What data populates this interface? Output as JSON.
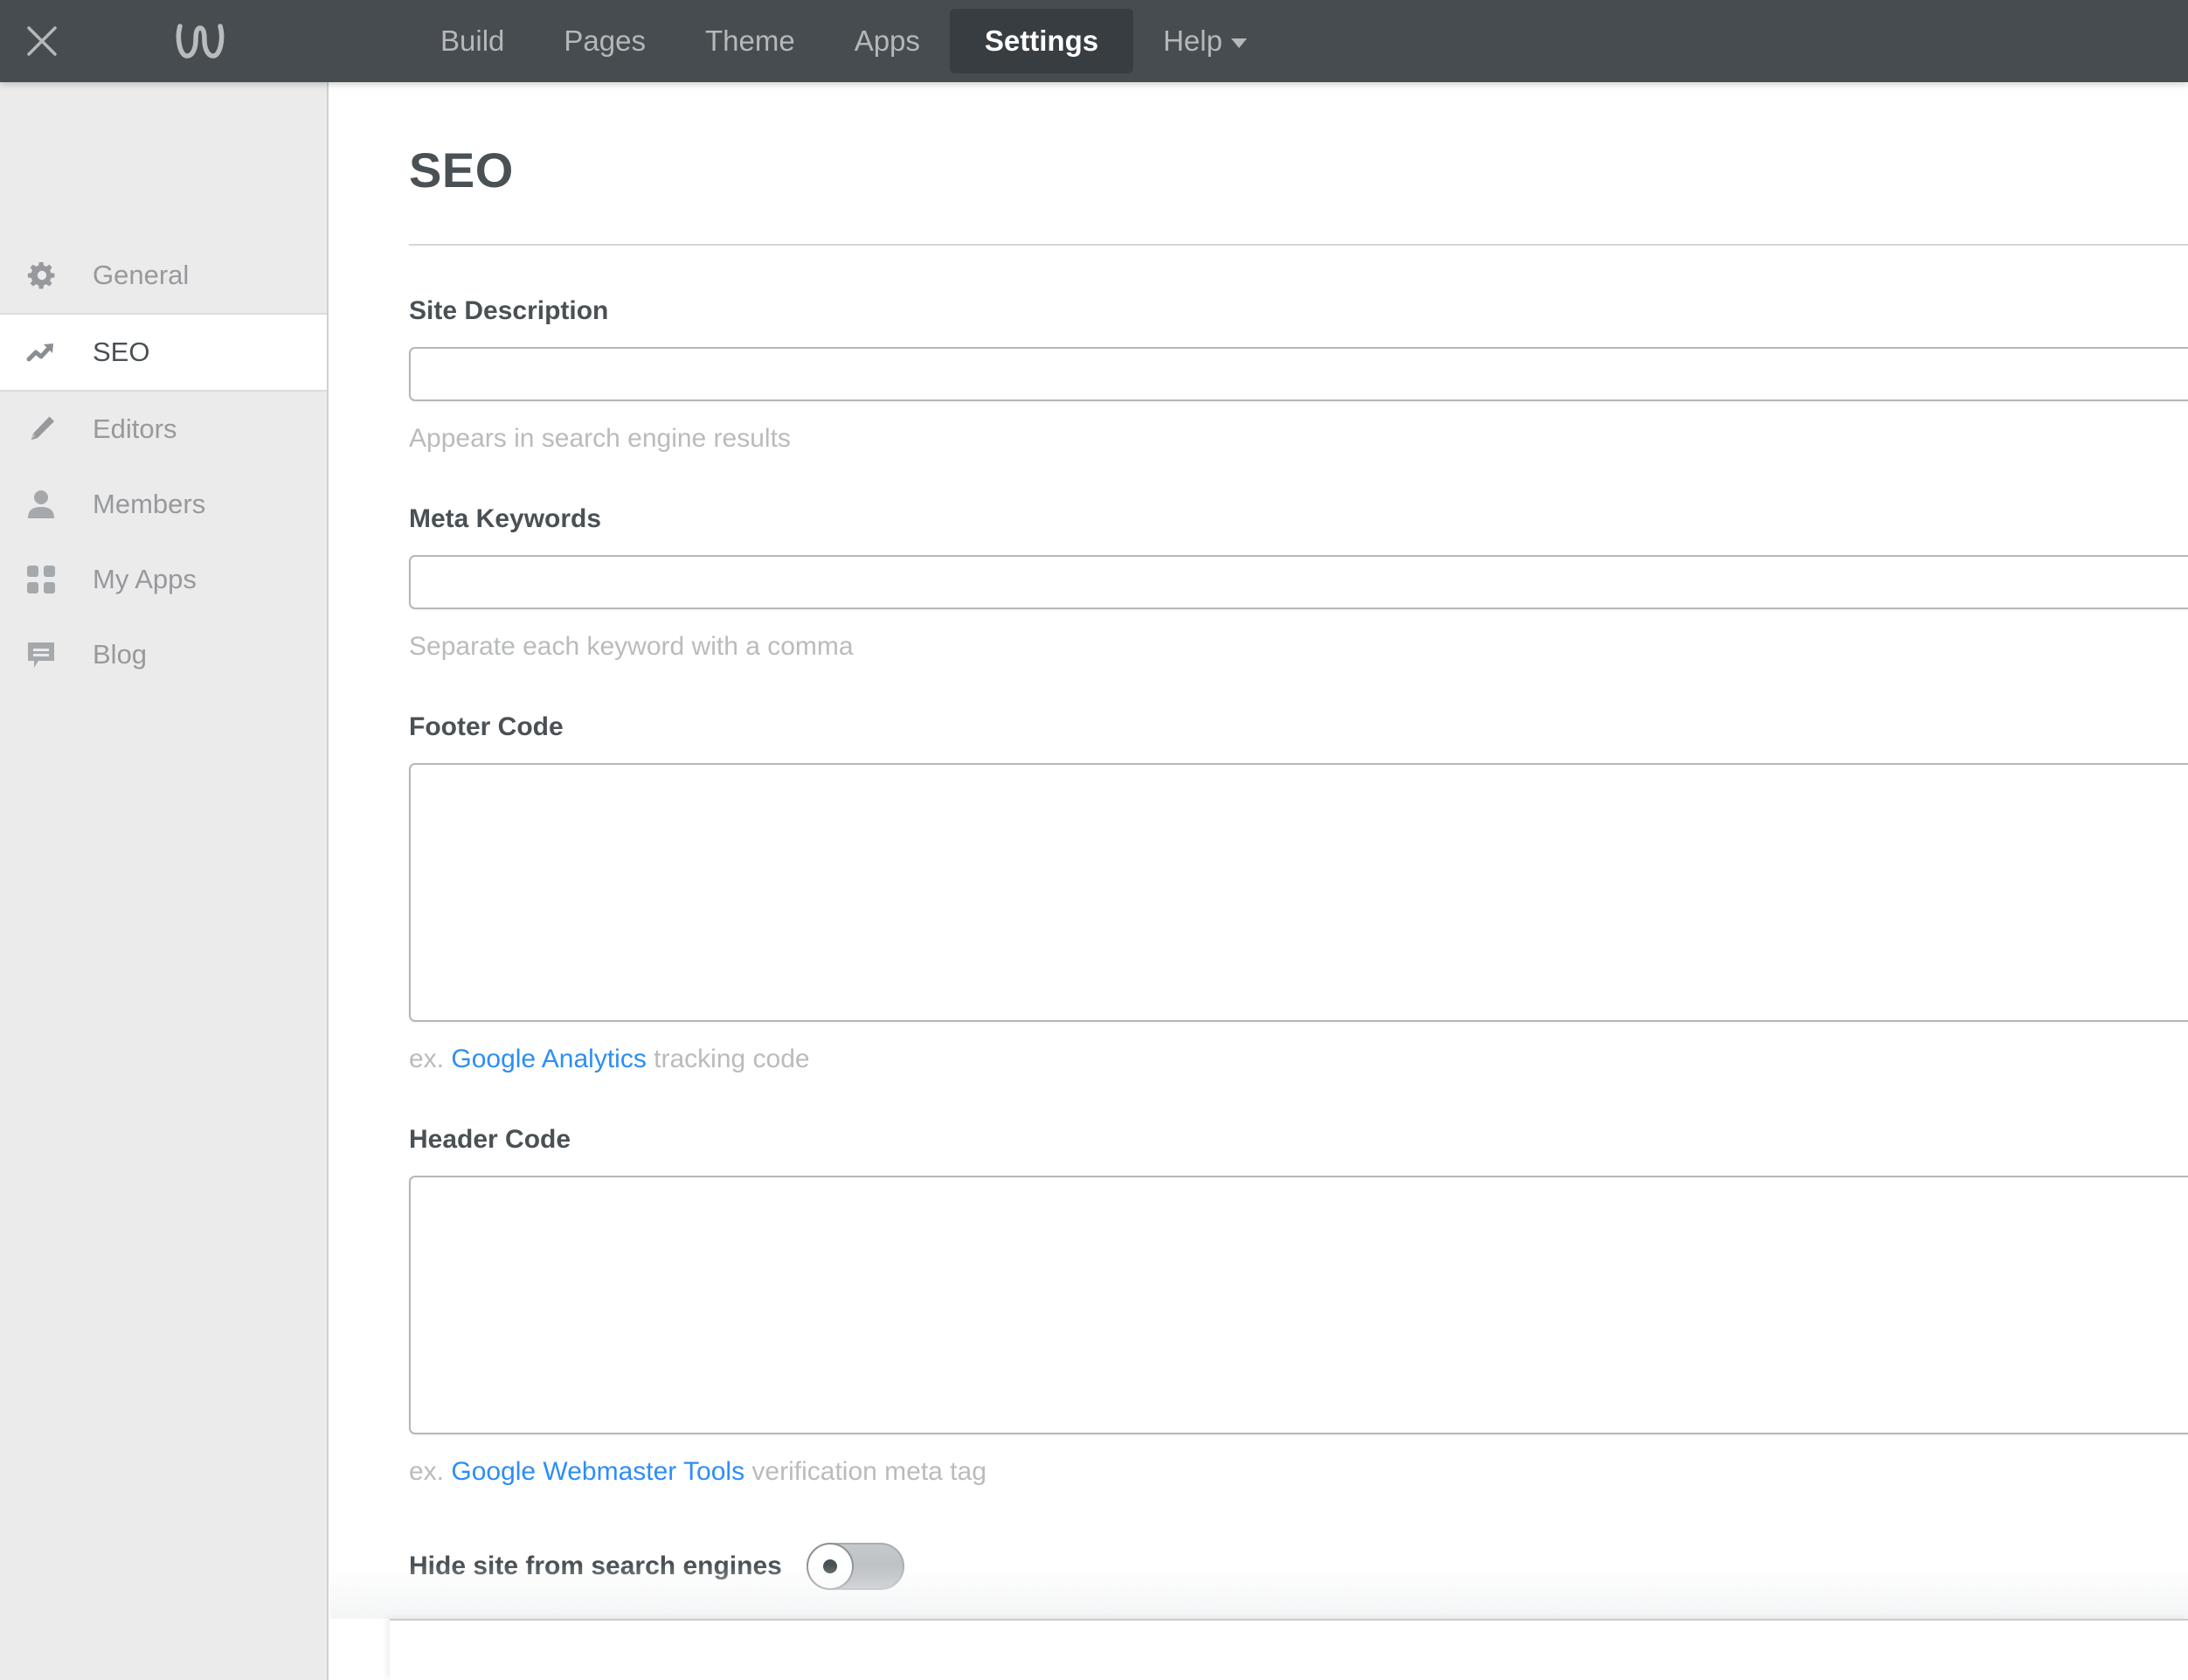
{
  "topbar": {
    "close_icon": "close-icon",
    "logo_icon": "weebly-logo-icon",
    "nav": [
      {
        "label": "Build",
        "active": false,
        "caret": false
      },
      {
        "label": "Pages",
        "active": false,
        "caret": false
      },
      {
        "label": "Theme",
        "active": false,
        "caret": false
      },
      {
        "label": "Apps",
        "active": false,
        "caret": false
      },
      {
        "label": "Settings",
        "active": true,
        "caret": false
      },
      {
        "label": "Help",
        "active": false,
        "caret": true
      }
    ],
    "background_color": "#464c50",
    "active_tab_color": "#383d41",
    "inactive_text_color": "#b4b8ba"
  },
  "sidebar": {
    "background_color": "#ebebeb",
    "items": [
      {
        "label": "General",
        "icon": "gear-icon",
        "active": false
      },
      {
        "label": "SEO",
        "icon": "trend-up-icon",
        "active": true
      },
      {
        "label": "Editors",
        "icon": "pencil-icon",
        "active": false
      },
      {
        "label": "Members",
        "icon": "person-icon",
        "active": false
      },
      {
        "label": "My Apps",
        "icon": "grid-icon",
        "active": false
      },
      {
        "label": "Blog",
        "icon": "chat-bubble-icon",
        "active": false
      }
    ]
  },
  "main": {
    "title": "SEO",
    "fields": [
      {
        "label": "Site Description",
        "type": "input",
        "value": "",
        "placeholder": "",
        "helper_prefix": "Appears in search engine results",
        "helper_link": "",
        "helper_suffix": ""
      },
      {
        "label": "Meta Keywords",
        "type": "input",
        "value": "",
        "placeholder": "",
        "helper_prefix": "Separate each keyword with a comma",
        "helper_link": "",
        "helper_suffix": ""
      },
      {
        "label": "Footer Code",
        "type": "textarea",
        "value": "",
        "placeholder": "",
        "helper_prefix": "ex. ",
        "helper_link": "Google Analytics",
        "helper_suffix": " tracking code"
      },
      {
        "label": "Header Code",
        "type": "textarea",
        "value": "",
        "placeholder": "",
        "helper_prefix": "ex. ",
        "helper_link": "Google Webmaster Tools",
        "helper_suffix": " verification meta tag"
      }
    ],
    "toggle": {
      "label": "Hide site from search engines",
      "state": "off"
    },
    "link_color": "#2d8ef5",
    "helper_text_color": "#b9bbbd",
    "label_color": "#4a5155"
  }
}
